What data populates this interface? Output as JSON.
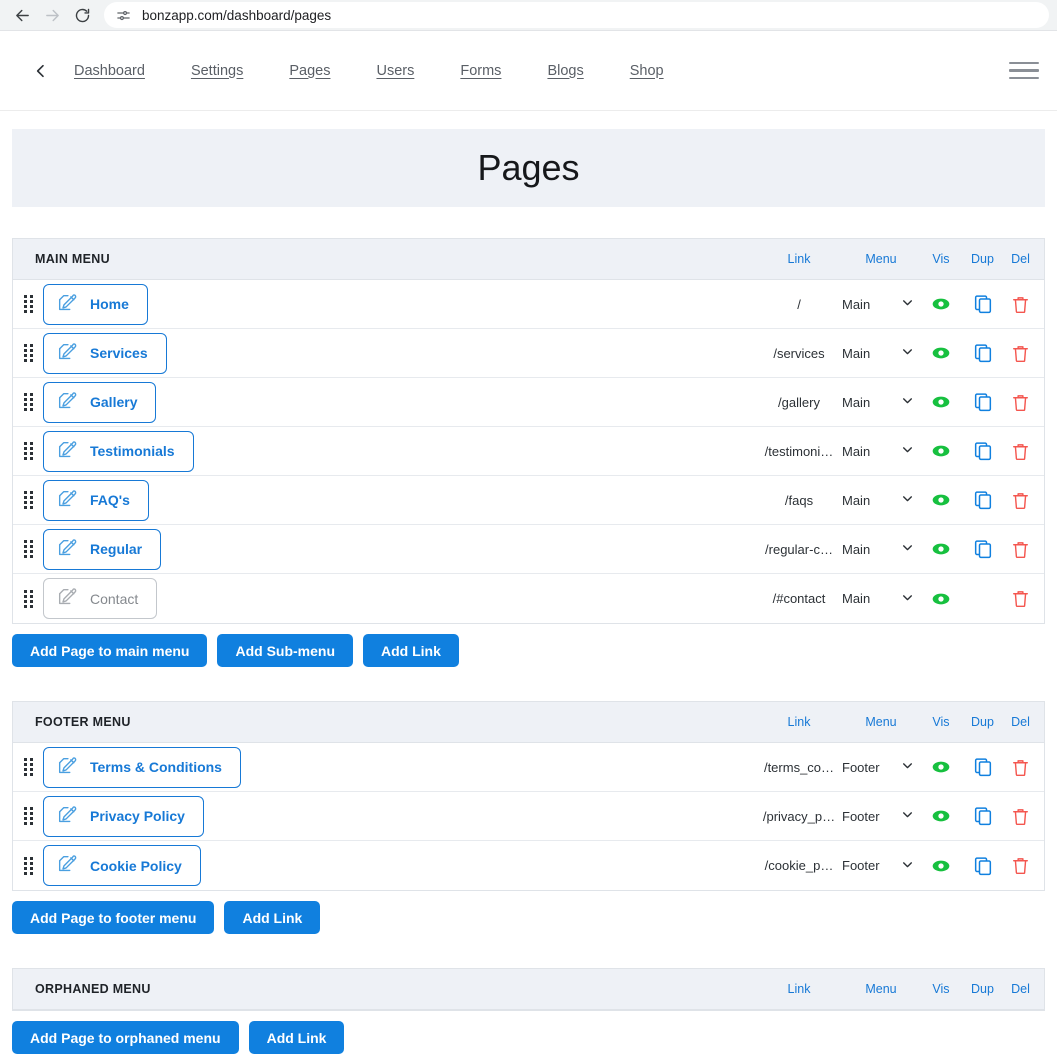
{
  "browser": {
    "back_icon": "arrow-left-icon",
    "forward_icon": "arrow-right-icon",
    "reload_icon": "reload-icon",
    "site_settings_icon": "tune-icon",
    "url": "bonzapp.com/dashboard/pages"
  },
  "app_nav": {
    "back_icon": "chevron-left-icon",
    "menu_icon": "hamburger-icon",
    "links": [
      {
        "label": "Dashboard"
      },
      {
        "label": "Settings"
      },
      {
        "label": "Pages"
      },
      {
        "label": "Users"
      },
      {
        "label": "Forms"
      },
      {
        "label": "Blogs"
      },
      {
        "label": "Shop"
      }
    ]
  },
  "page": {
    "title": "Pages"
  },
  "columns": {
    "link": "Link",
    "menu": "Menu",
    "vis": "Vis",
    "dup": "Dup",
    "del": "Del"
  },
  "icons": {
    "drag": "drag-handle-icon",
    "edit": "edit-pencil-icon",
    "visible": "eye-icon",
    "duplicate": "copy-icon",
    "delete": "trash-icon",
    "chevron": "chevron-down-icon"
  },
  "colors": {
    "accent_blue": "#1080df",
    "link_blue": "#1779d6",
    "eye_green": "#17c03f",
    "trash_red": "#f4564f",
    "banner_bg": "#eef1f6"
  },
  "sections": [
    {
      "title": "MAIN MENU",
      "rows": [
        {
          "name": "Home",
          "link": "/",
          "menu": "Main",
          "disabled": false,
          "has_dup": true
        },
        {
          "name": "Services",
          "link": "/services",
          "menu": "Main",
          "disabled": false,
          "has_dup": true
        },
        {
          "name": "Gallery",
          "link": "/gallery",
          "menu": "Main",
          "disabled": false,
          "has_dup": true
        },
        {
          "name": "Testimonials",
          "link": "/testimoni…",
          "menu": "Main",
          "disabled": false,
          "has_dup": true
        },
        {
          "name": "FAQ's",
          "link": "/faqs",
          "menu": "Main",
          "disabled": false,
          "has_dup": true
        },
        {
          "name": "Regular",
          "link": "/regular-c…",
          "menu": "Main",
          "disabled": false,
          "has_dup": true
        },
        {
          "name": "Contact",
          "link": "/#contact",
          "menu": "Main",
          "disabled": true,
          "has_dup": false
        }
      ],
      "actions": [
        {
          "label": "Add Page to main menu"
        },
        {
          "label": "Add Sub-menu"
        },
        {
          "label": "Add Link"
        }
      ]
    },
    {
      "title": "FOOTER MENU",
      "rows": [
        {
          "name": "Terms & Conditions",
          "link": "/terms_co…",
          "menu": "Footer",
          "disabled": false,
          "has_dup": true
        },
        {
          "name": "Privacy Policy",
          "link": "/privacy_p…",
          "menu": "Footer",
          "disabled": false,
          "has_dup": true
        },
        {
          "name": "Cookie Policy",
          "link": "/cookie_p…",
          "menu": "Footer",
          "disabled": false,
          "has_dup": true
        }
      ],
      "actions": [
        {
          "label": "Add Page to footer menu"
        },
        {
          "label": "Add Link"
        }
      ]
    },
    {
      "title": "ORPHANED MENU",
      "rows": [],
      "actions": [
        {
          "label": "Add Page to orphaned menu"
        },
        {
          "label": "Add Link"
        }
      ]
    }
  ]
}
